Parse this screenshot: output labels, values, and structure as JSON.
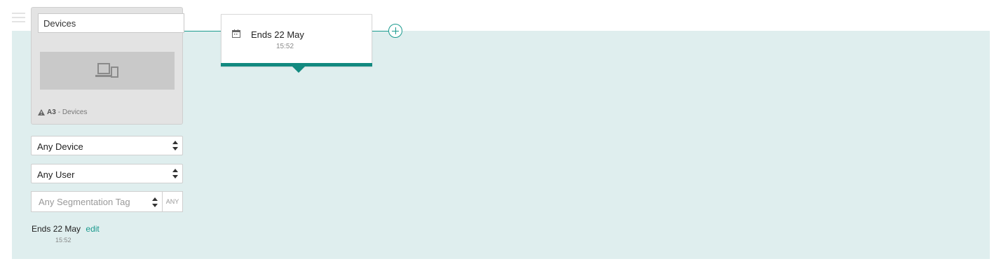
{
  "block": {
    "name_value": "Devices",
    "warning_code": "A3",
    "warning_text": " - Devices"
  },
  "filters": {
    "device": "Any Device",
    "user": "Any User",
    "segmentation_placeholder": "Any Segmentation Tag",
    "segmentation_mode": "ANY"
  },
  "schedule": {
    "ends_label": "Ends",
    "ends_date": "22 May",
    "ends_time": "15:52",
    "edit_label": "edit"
  },
  "colors": {
    "accent": "#1a9a8e",
    "canvas": "#dfeeee"
  },
  "icons": [
    "menu-icon",
    "devices-icon",
    "warning-icon",
    "calendar-icon",
    "add-icon",
    "sort-icon"
  ]
}
